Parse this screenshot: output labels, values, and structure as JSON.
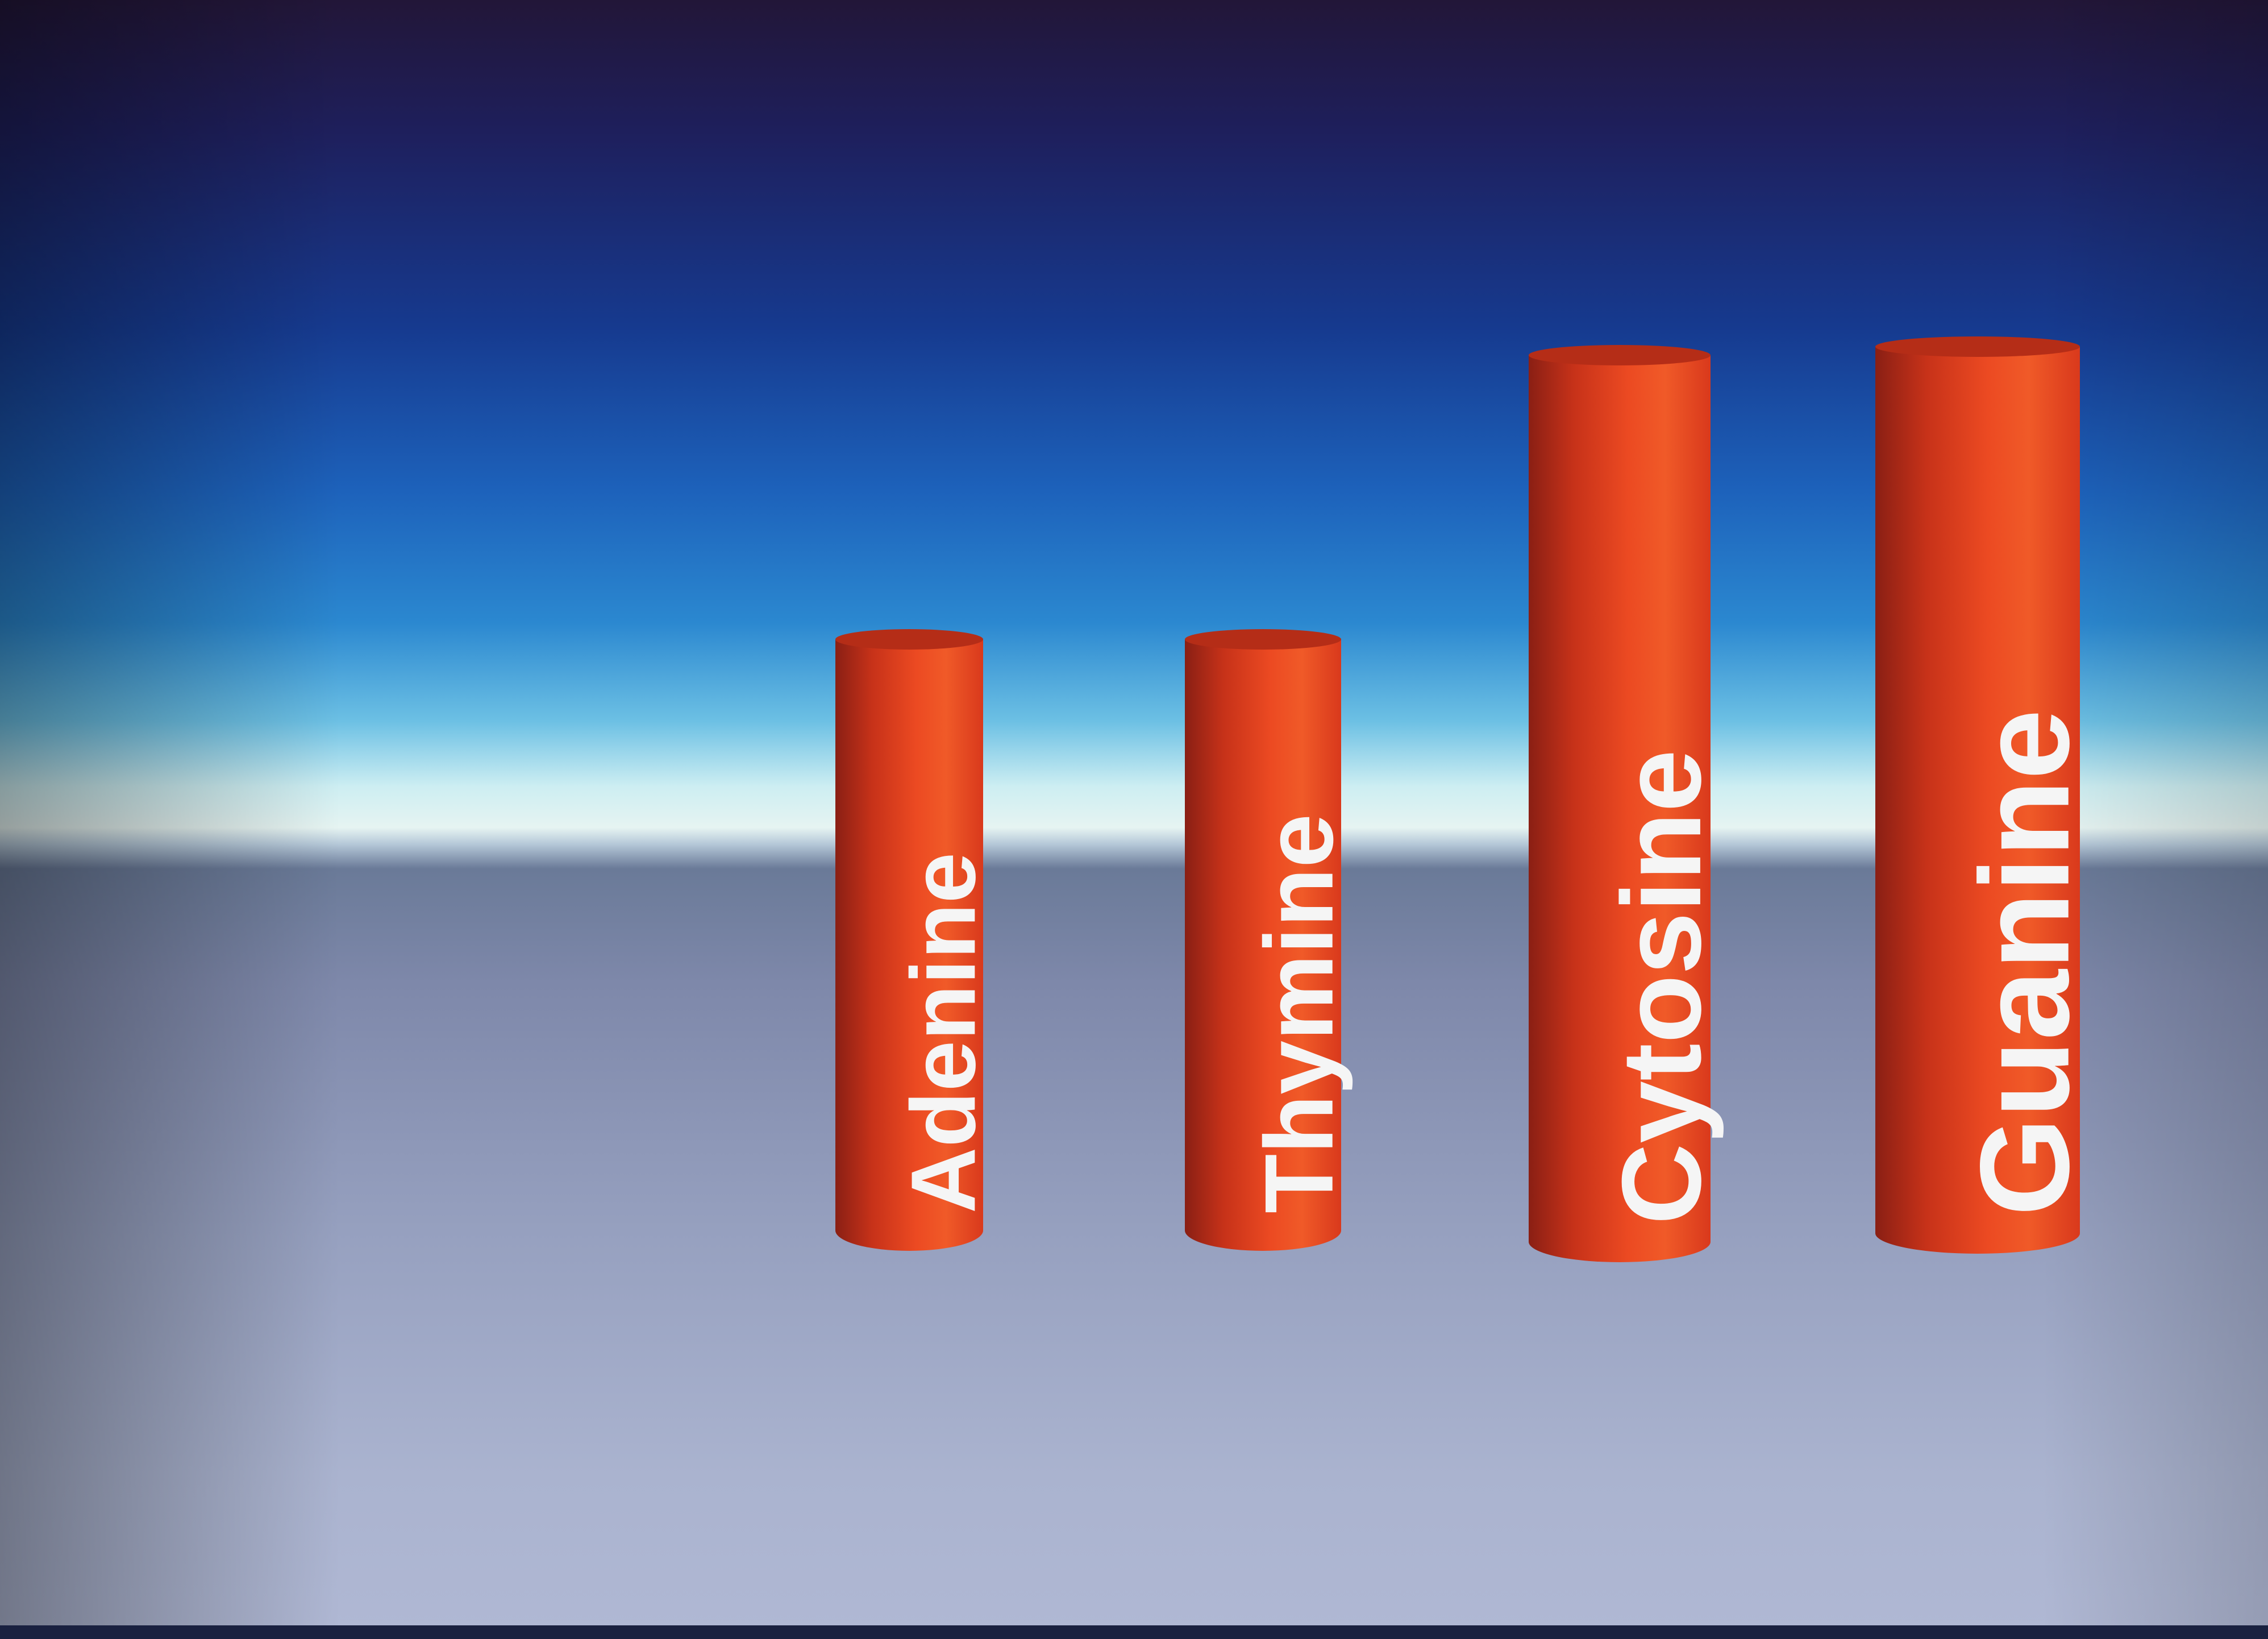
{
  "chart_data": {
    "type": "bar",
    "style": "3d-cylinder",
    "categories": [
      "Adenine",
      "Thymine",
      "Cytosine",
      "Guanine"
    ],
    "values": [
      1,
      1,
      1.5,
      1.5
    ],
    "label_orientation": "vertical",
    "colors": {
      "bar": "#e5441f",
      "bar_dark": "#9c2412",
      "label": "#f5f5f5",
      "sky_top": "#1b1640",
      "sky_mid": "#1d5fb8",
      "horizon": "#d9eef2",
      "floor": "#9aa2c0"
    }
  }
}
